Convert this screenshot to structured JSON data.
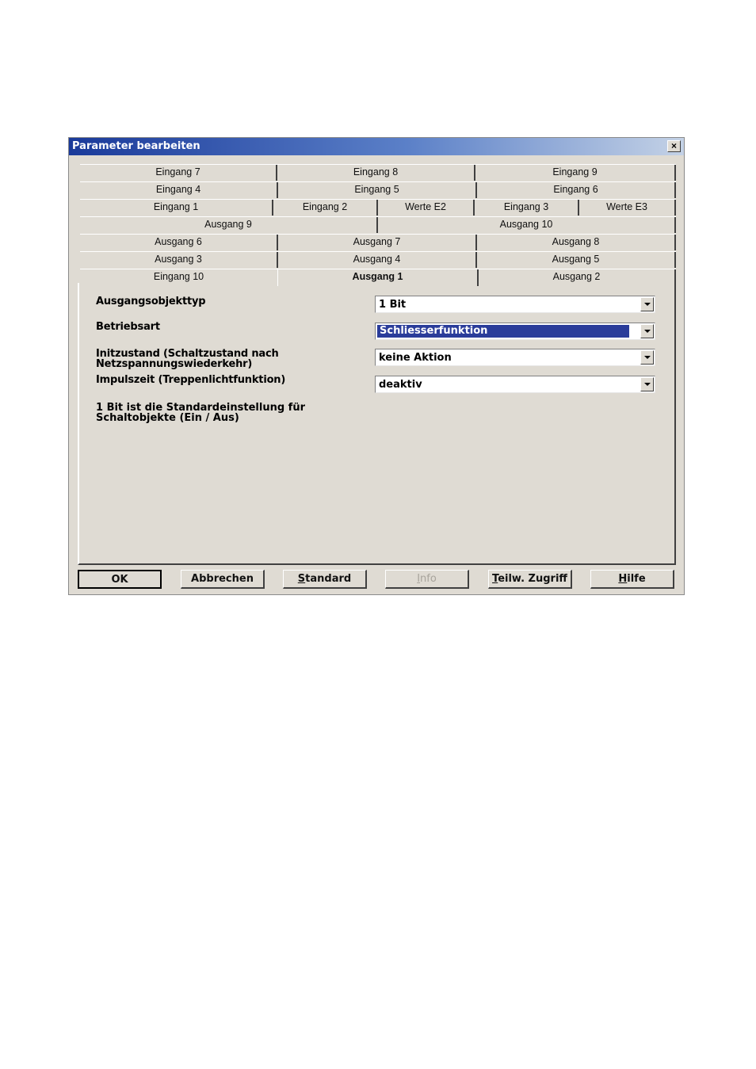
{
  "window": {
    "title": "Parameter bearbeiten",
    "close_glyph": "×"
  },
  "tabs": {
    "rows": [
      [
        "Eingang 7",
        "Eingang 8",
        "Eingang 9"
      ],
      [
        "Eingang 4",
        "Eingang 5",
        "Eingang 6"
      ],
      [
        "Eingang 1",
        "Eingang 2",
        "Werte E2",
        "Eingang 3",
        "Werte E3"
      ],
      [
        "Ausgang 9",
        "Ausgang 10"
      ],
      [
        "Ausgang 6",
        "Ausgang 7",
        "Ausgang 8"
      ],
      [
        "Ausgang 3",
        "Ausgang 4",
        "Ausgang 5"
      ],
      [
        "Eingang 10",
        "Ausgang 1",
        "Ausgang 2"
      ]
    ],
    "active": "Ausgang 1"
  },
  "params": [
    {
      "label": "Ausgangsobjekttyp",
      "value": "1 Bit"
    },
    {
      "label": "Betriebsart",
      "value": "Schliesserfunktion"
    },
    {
      "label_line1": "Initzustand (Schaltzustand nach",
      "label_line2": "Netzspannungswiederkehr)",
      "value": "keine Aktion"
    },
    {
      "label": "Impulszeit (Treppenlichtfunktion)",
      "value": "deaktiv"
    }
  ],
  "info": {
    "line1": "1 Bit ist die Standardeinstellung für",
    "line2": "Schaltobjekte (Ein / Aus)"
  },
  "buttons": {
    "ok": "OK",
    "cancel": "Abbrechen",
    "standard_u": "S",
    "standard_rest": "tandard",
    "info_u": "I",
    "info_rest": "nfo",
    "partial_u": "T",
    "partial_rest": "eilw. Zugriff",
    "help_u": "H",
    "help_rest": "ilfe"
  }
}
